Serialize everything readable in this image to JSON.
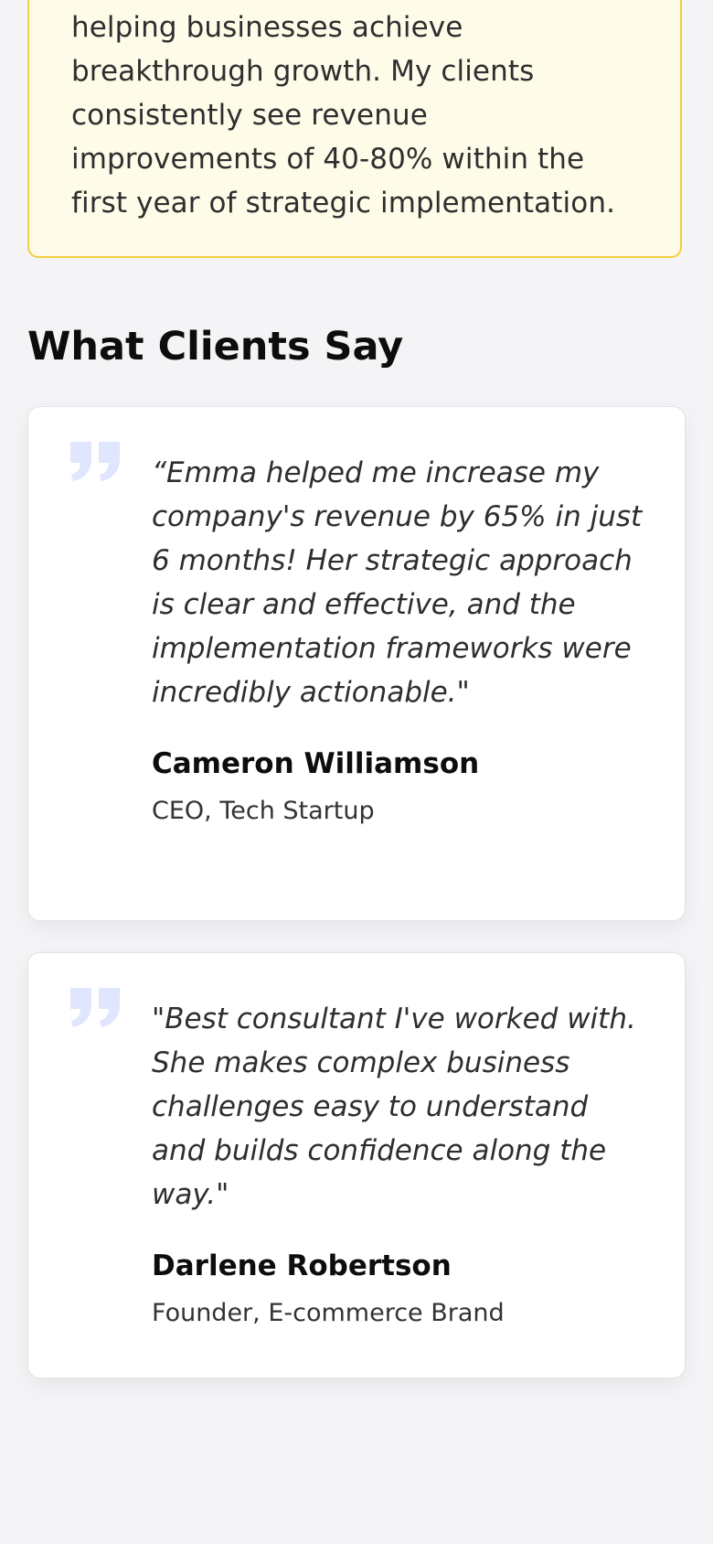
{
  "about": {
    "highlight_text": "helping businesses achieve breakthrough growth. My clients consistently see revenue improvements of 40-80% within the first year of strategic implementation."
  },
  "testimonials": {
    "title": "What Clients Say",
    "items": [
      {
        "quote": "“Emma helped me increase my company's revenue by 65% in just 6 months! Her strategic approach is clear and effective, and the implementation frameworks were incredibly actionable.\"",
        "name": "Cameron Williamson",
        "role": "CEO, Tech Startup"
      },
      {
        "quote": "\"Best consultant I've worked with. She makes complex business challenges easy to understand and builds confidence along the way.\"",
        "name": "Darlene Robertson",
        "role": "Founder, E-commerce Brand"
      }
    ],
    "quote_icon": "quote-icon",
    "quote_icon_color": "#dfe6fd"
  },
  "colors": {
    "highlight_bg": "#fefbe9",
    "highlight_border": "#f2cf3c",
    "page_bg": "#f4f4f6"
  }
}
